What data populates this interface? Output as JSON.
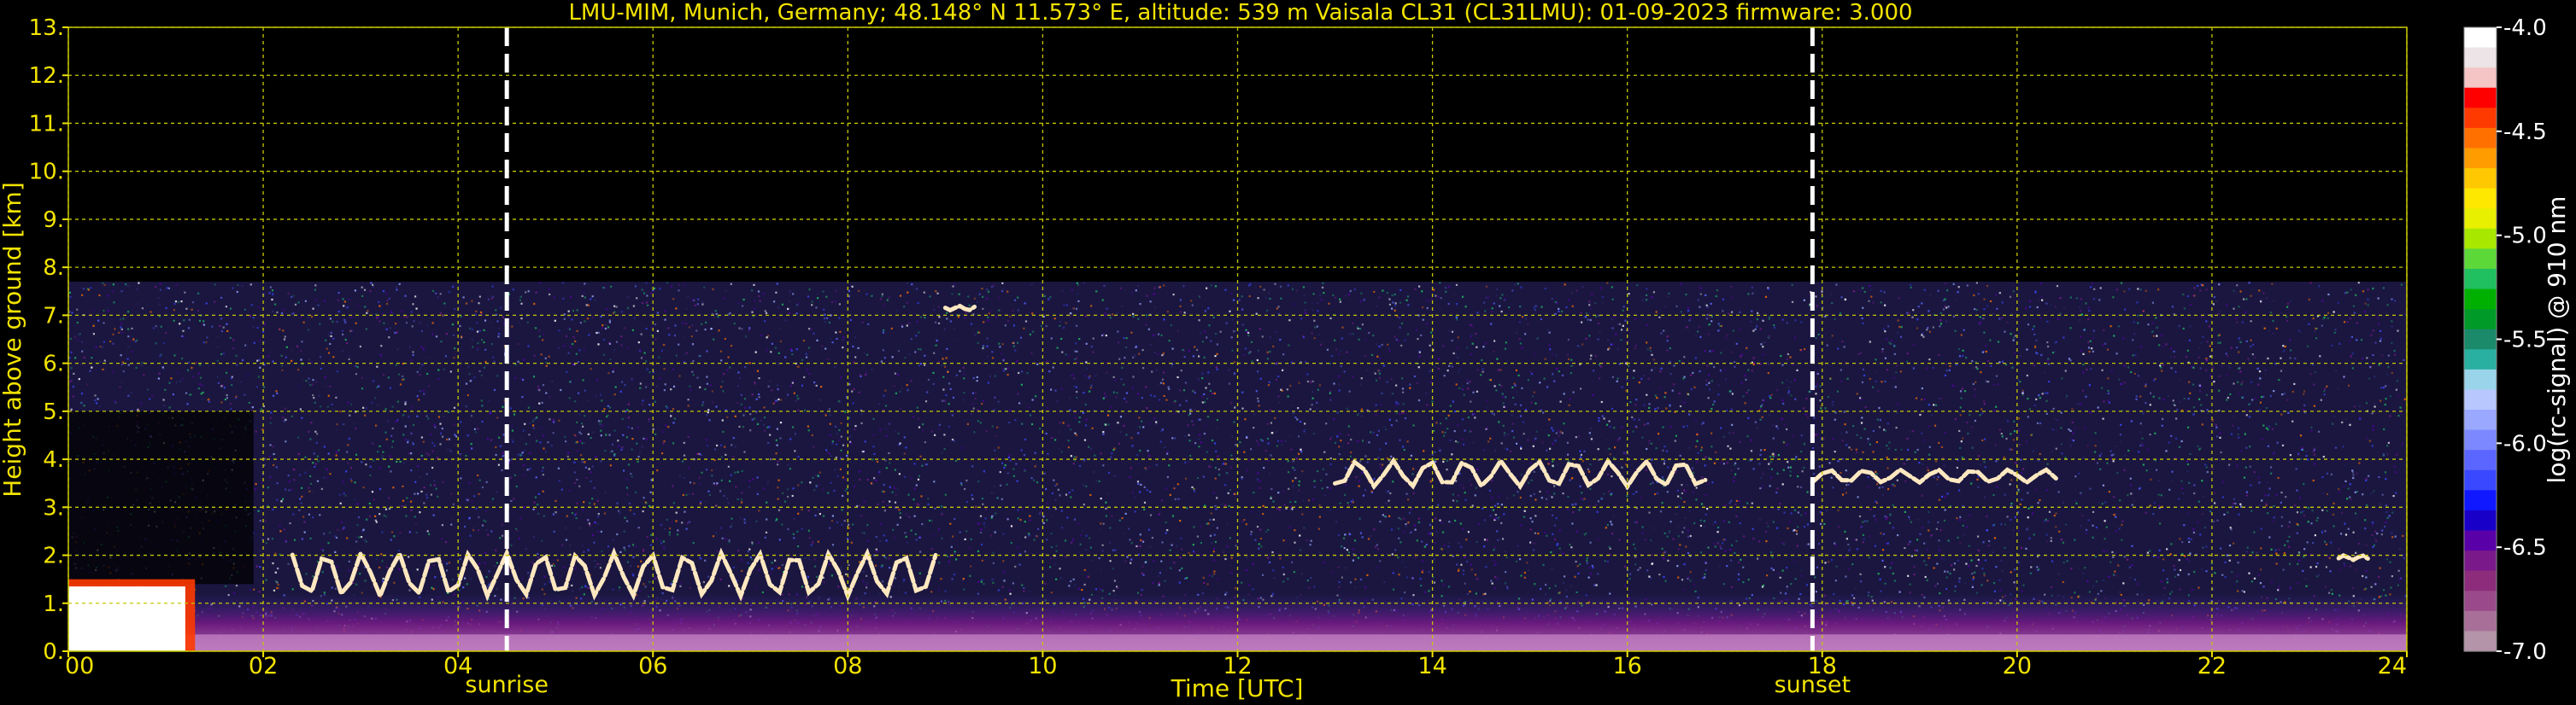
{
  "chart_data": {
    "type": "heatmap",
    "title": "LMU-MIM, Munich, Germany; 48.148° N 11.573° E, altitude: 539 m    Vaisala CL31 (CL31LMU): 01-09-2023    firmware: 3.000",
    "xlabel": "Time [UTC]",
    "ylabel": "Height above ground [km]",
    "xlim": [
      0,
      24
    ],
    "ylim": [
      0,
      13
    ],
    "x_ticks": [
      "00",
      "02",
      "04",
      "06",
      "08",
      "10",
      "12",
      "14",
      "16",
      "18",
      "20",
      "22",
      "24"
    ],
    "y_ticks": [
      "0.",
      "1.",
      "2.",
      "3.",
      "4.",
      "5.",
      "6.",
      "7.",
      "8.",
      "9.",
      "10.",
      "11.",
      "12.",
      "13."
    ],
    "grid": true,
    "colors": {
      "background": "#000000",
      "text": "#f2e300",
      "grid": "#c8c800",
      "event_lines": "#ffffff"
    },
    "signal_top_km": 7.7,
    "events": [
      {
        "label": "sunrise",
        "x": 4.5
      },
      {
        "label": "sunset",
        "x": 17.9
      }
    ],
    "colorbar": {
      "label": "log(rc-signal) @ 910 nm",
      "range": [
        -7.0,
        -4.0
      ],
      "ticks": [
        "-4.0",
        "-4.5",
        "-5.0",
        "-5.5",
        "-6.0",
        "-6.5",
        "-7.0"
      ],
      "colors": [
        "#ffffff",
        "#ece4e6",
        "#f5c4c4",
        "#ff0000",
        "#ff3a00",
        "#ff7000",
        "#ff9c00",
        "#ffc800",
        "#ffe800",
        "#e8f000",
        "#a8e800",
        "#5cd838",
        "#20c060",
        "#00b000",
        "#009a28",
        "#1a8a6a",
        "#2ab0a0",
        "#9ad4ea",
        "#b8c8ff",
        "#9aa8ff",
        "#7c88ff",
        "#5a66ff",
        "#3a48ff",
        "#1018ff",
        "#1800c8",
        "#5a00a8",
        "#7a1a8a",
        "#8c2c7a",
        "#9a4a8a",
        "#a87098",
        "#b494a8"
      ]
    },
    "features": [
      {
        "name": "surface aerosol layer",
        "x": [
          0,
          24
        ],
        "y": [
          0.0,
          0.35
        ]
      },
      {
        "name": "low cloud",
        "x": [
          0.0,
          1.3
        ],
        "y": [
          0.0,
          1.5
        ]
      },
      {
        "name": "boundary layer top",
        "x": [
          2.3,
          8.9
        ],
        "y": [
          1.1,
          2.1
        ]
      },
      {
        "name": "cloud layer",
        "x": [
          9.0,
          9.3
        ],
        "y": [
          7.1,
          7.2
        ]
      },
      {
        "name": "cloud layer",
        "x": [
          13.0,
          16.8
        ],
        "y": [
          3.4,
          4.0
        ]
      },
      {
        "name": "cloud layer",
        "x": [
          17.9,
          20.4
        ],
        "y": [
          3.5,
          3.8
        ]
      },
      {
        "name": "cloud layer",
        "x": [
          23.3,
          23.6
        ],
        "y": [
          1.9,
          2.0
        ]
      }
    ]
  }
}
